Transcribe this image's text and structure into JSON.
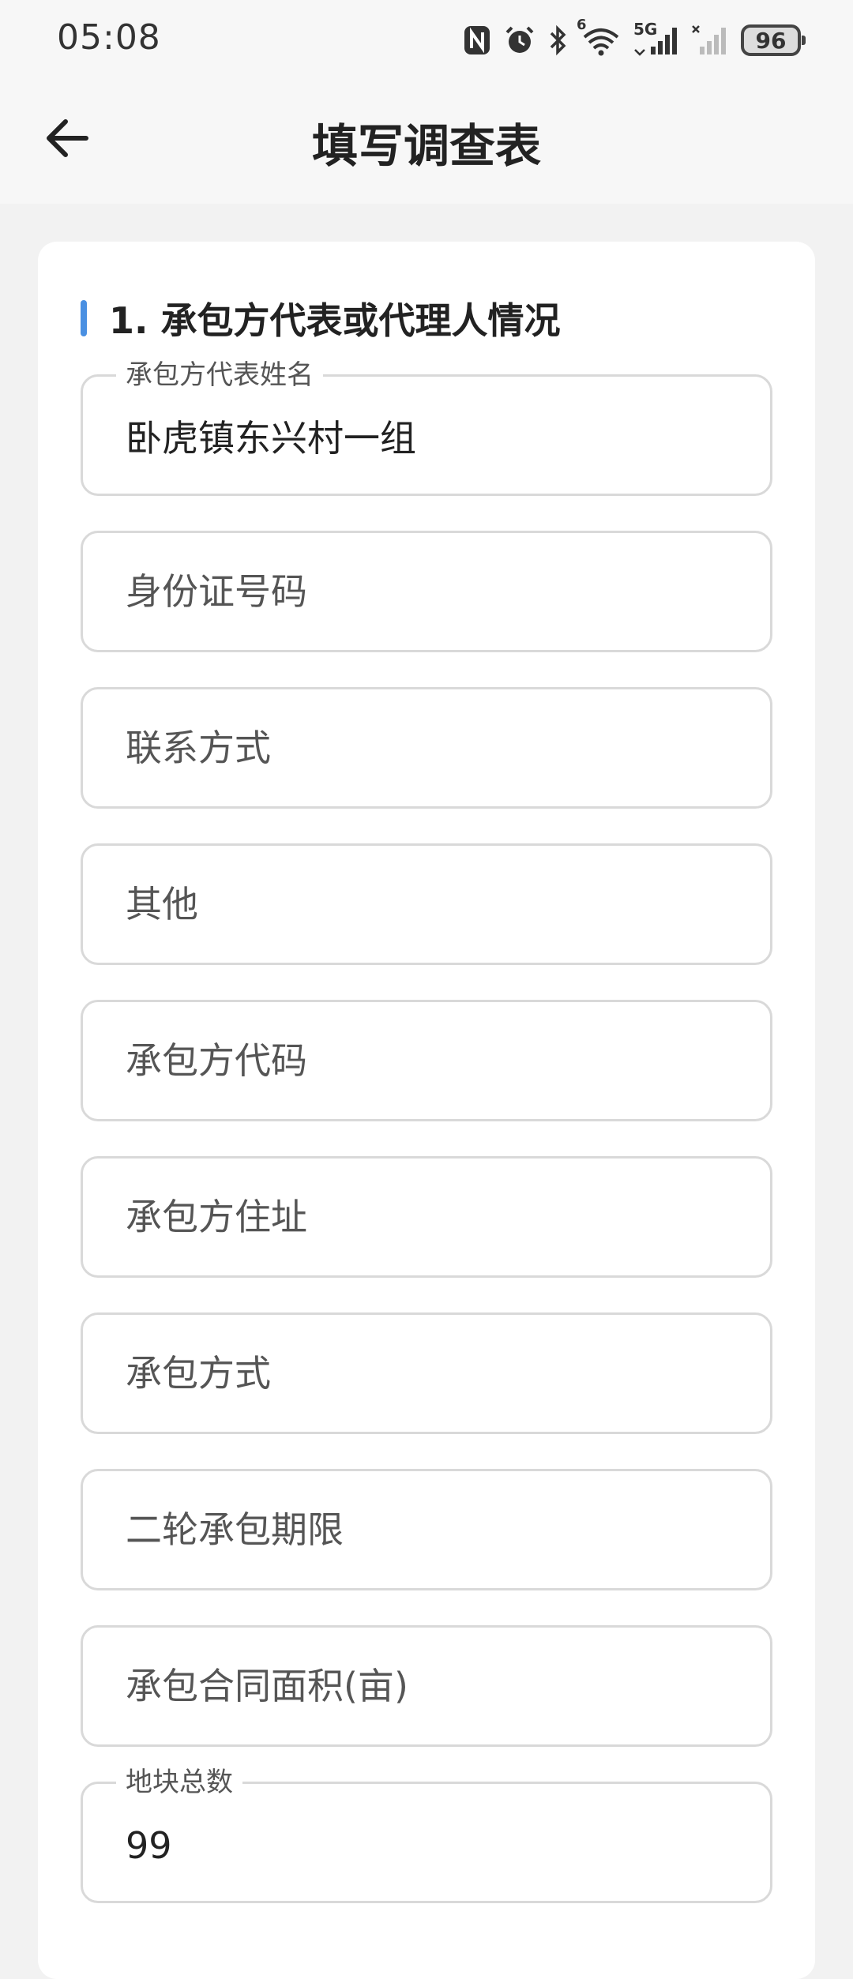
{
  "status_bar": {
    "time": "05:08",
    "battery": "96",
    "icons": [
      "nfc-icon",
      "alarm-icon",
      "bluetooth-icon",
      "wifi-icon",
      "signal-5g-icon",
      "signal-no-sim-icon",
      "battery-icon"
    ],
    "network_label": "5G",
    "wifi_label": "6"
  },
  "header": {
    "title": "填写调查表",
    "back_icon": "arrow-left-icon"
  },
  "section": {
    "title": "1. 承包方代表或代理人情况",
    "accent_color": "#4a90e2"
  },
  "fields": [
    {
      "label": "承包方代表姓名",
      "value": "卧虎镇东兴村一组",
      "placeholder": ""
    },
    {
      "label": "",
      "value": "",
      "placeholder": "身份证号码"
    },
    {
      "label": "",
      "value": "",
      "placeholder": "联系方式"
    },
    {
      "label": "",
      "value": "",
      "placeholder": "其他"
    },
    {
      "label": "",
      "value": "",
      "placeholder": "承包方代码"
    },
    {
      "label": "",
      "value": "",
      "placeholder": "承包方住址"
    },
    {
      "label": "",
      "value": "",
      "placeholder": "承包方式"
    },
    {
      "label": "",
      "value": "",
      "placeholder": "二轮承包期限"
    },
    {
      "label": "",
      "value": "",
      "placeholder": "承包合同面积(亩)"
    },
    {
      "label": "地块总数",
      "value": "99",
      "placeholder": ""
    }
  ]
}
